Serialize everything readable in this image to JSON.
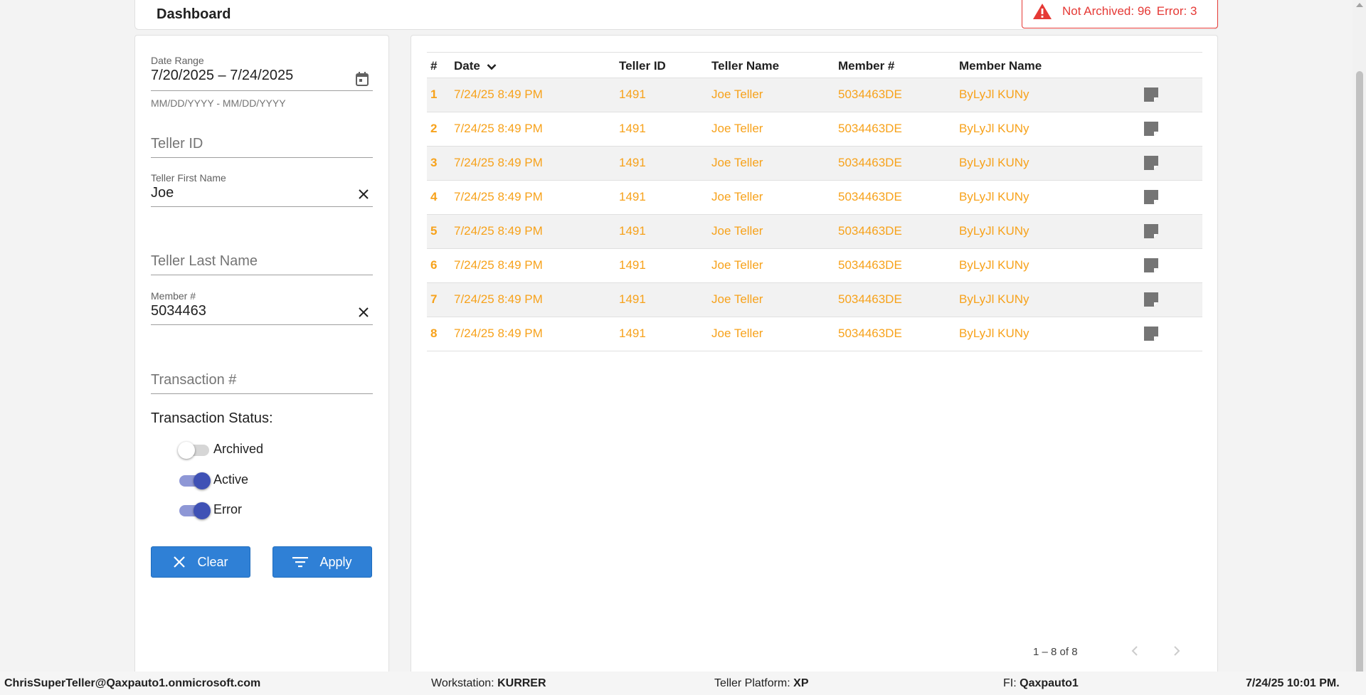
{
  "header": {
    "title": "Dashboard",
    "alert": {
      "not_archived_label": "Not Archived: 96",
      "error_label": "Error: 3",
      "color": "#e53935",
      "icon": "warning-icon"
    }
  },
  "filters": {
    "date_range": {
      "label": "Date Range",
      "value": "7/20/2025 – 7/24/2025",
      "hint": "MM/DD/YYYY - MM/DD/YYYY",
      "icon": "calendar-icon"
    },
    "teller_id": {
      "placeholder": "Teller ID"
    },
    "teller_first_name": {
      "label": "Teller First Name",
      "value": "Joe",
      "clear_icon": "close-icon"
    },
    "teller_last_name": {
      "placeholder": "Teller Last Name"
    },
    "member_number": {
      "label": "Member #",
      "value": "5034463",
      "clear_icon": "close-icon"
    },
    "transaction_number": {
      "placeholder": "Transaction #"
    },
    "status_heading": "Transaction Status:",
    "statuses": [
      {
        "label": "Archived",
        "on": false
      },
      {
        "label": "Active",
        "on": true
      },
      {
        "label": "Error",
        "on": true
      }
    ],
    "clear_label": "Clear",
    "apply_label": "Apply",
    "button_color": "#2f80d6"
  },
  "table": {
    "columns": [
      "#",
      "Date",
      "Teller ID",
      "Teller Name",
      "Member #",
      "Member Name"
    ],
    "sort_icon": "chevron-down-icon",
    "row_text_color": "#f7a21b",
    "rows": [
      {
        "idx": "1",
        "date": "7/24/25 8:49 PM",
        "teller_id": "1491",
        "teller_name": "Joe Teller",
        "member": "5034463DE",
        "member_name": "ByLyJl KUNy"
      },
      {
        "idx": "2",
        "date": "7/24/25 8:49 PM",
        "teller_id": "1491",
        "teller_name": "Joe Teller",
        "member": "5034463DE",
        "member_name": "ByLyJl KUNy"
      },
      {
        "idx": "3",
        "date": "7/24/25 8:49 PM",
        "teller_id": "1491",
        "teller_name": "Joe Teller",
        "member": "5034463DE",
        "member_name": "ByLyJl KUNy"
      },
      {
        "idx": "4",
        "date": "7/24/25 8:49 PM",
        "teller_id": "1491",
        "teller_name": "Joe Teller",
        "member": "5034463DE",
        "member_name": "ByLyJl KUNy"
      },
      {
        "idx": "5",
        "date": "7/24/25 8:49 PM",
        "teller_id": "1491",
        "teller_name": "Joe Teller",
        "member": "5034463DE",
        "member_name": "ByLyJl KUNy"
      },
      {
        "idx": "6",
        "date": "7/24/25 8:49 PM",
        "teller_id": "1491",
        "teller_name": "Joe Teller",
        "member": "5034463DE",
        "member_name": "ByLyJl KUNy"
      },
      {
        "idx": "7",
        "date": "7/24/25 8:49 PM",
        "teller_id": "1491",
        "teller_name": "Joe Teller",
        "member": "5034463DE",
        "member_name": "ByLyJl KUNy"
      },
      {
        "idx": "8",
        "date": "7/24/25 8:49 PM",
        "teller_id": "1491",
        "teller_name": "Joe Teller",
        "member": "5034463DE",
        "member_name": "ByLyJl KUNy"
      }
    ],
    "pagination": "1 – 8 of 8"
  },
  "footer": {
    "user": "ChrisSuperTeller@Qaxpauto1.onmicrosoft.com",
    "workstation_label": "Workstation:",
    "workstation": "KURRER",
    "platform_label": "Teller Platform:",
    "platform": "XP",
    "fi_label": "FI:",
    "fi": "Qaxpauto1",
    "datetime": "7/24/25 10:01 PM."
  }
}
